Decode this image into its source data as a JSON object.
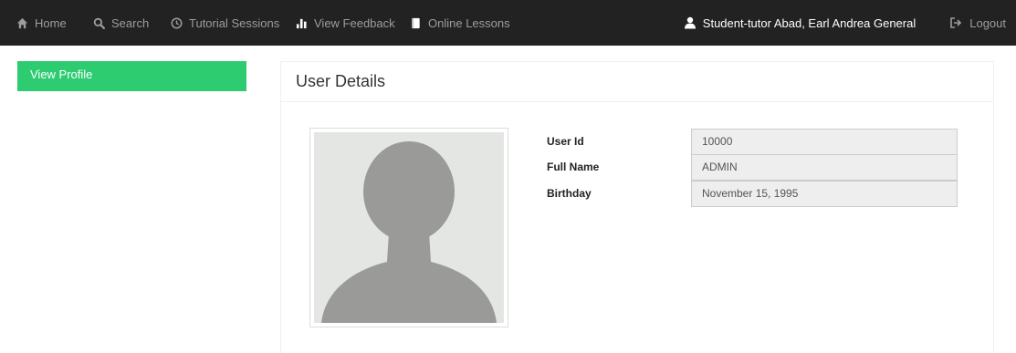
{
  "navbar": {
    "items": [
      {
        "label": "Home",
        "icon": "home-icon"
      },
      {
        "label": "Search",
        "icon": "search-icon"
      },
      {
        "label": "Tutorial Sessions",
        "icon": "clock-icon"
      },
      {
        "label": "View Feedback",
        "icon": "bar-chart-icon"
      },
      {
        "label": "Online Lessons",
        "icon": "book-icon"
      }
    ],
    "user": {
      "label": "Student-tutor Abad, Earl Andrea General",
      "icon": "user-icon"
    },
    "logout": {
      "label": "Logout",
      "icon": "logout-icon"
    }
  },
  "sidebar": {
    "items": [
      {
        "label": "View Profile"
      }
    ]
  },
  "main": {
    "title": "User Details",
    "avatar": {
      "icon": "avatar-placeholder-icon"
    },
    "fields": [
      {
        "label": "User Id",
        "value": "10000"
      },
      {
        "label": "Full Name",
        "value": "ADMIN"
      },
      {
        "label": "Birthday",
        "value": "November 15, 1995"
      }
    ]
  },
  "colors": {
    "navbar_bg": "#222222",
    "nav_text": "#9d9d9d",
    "accent_green": "#2ecc71",
    "input_bg": "#eeeeee",
    "avatar_bg": "#e4e6e3",
    "avatar_fg": "#9a9b98"
  }
}
